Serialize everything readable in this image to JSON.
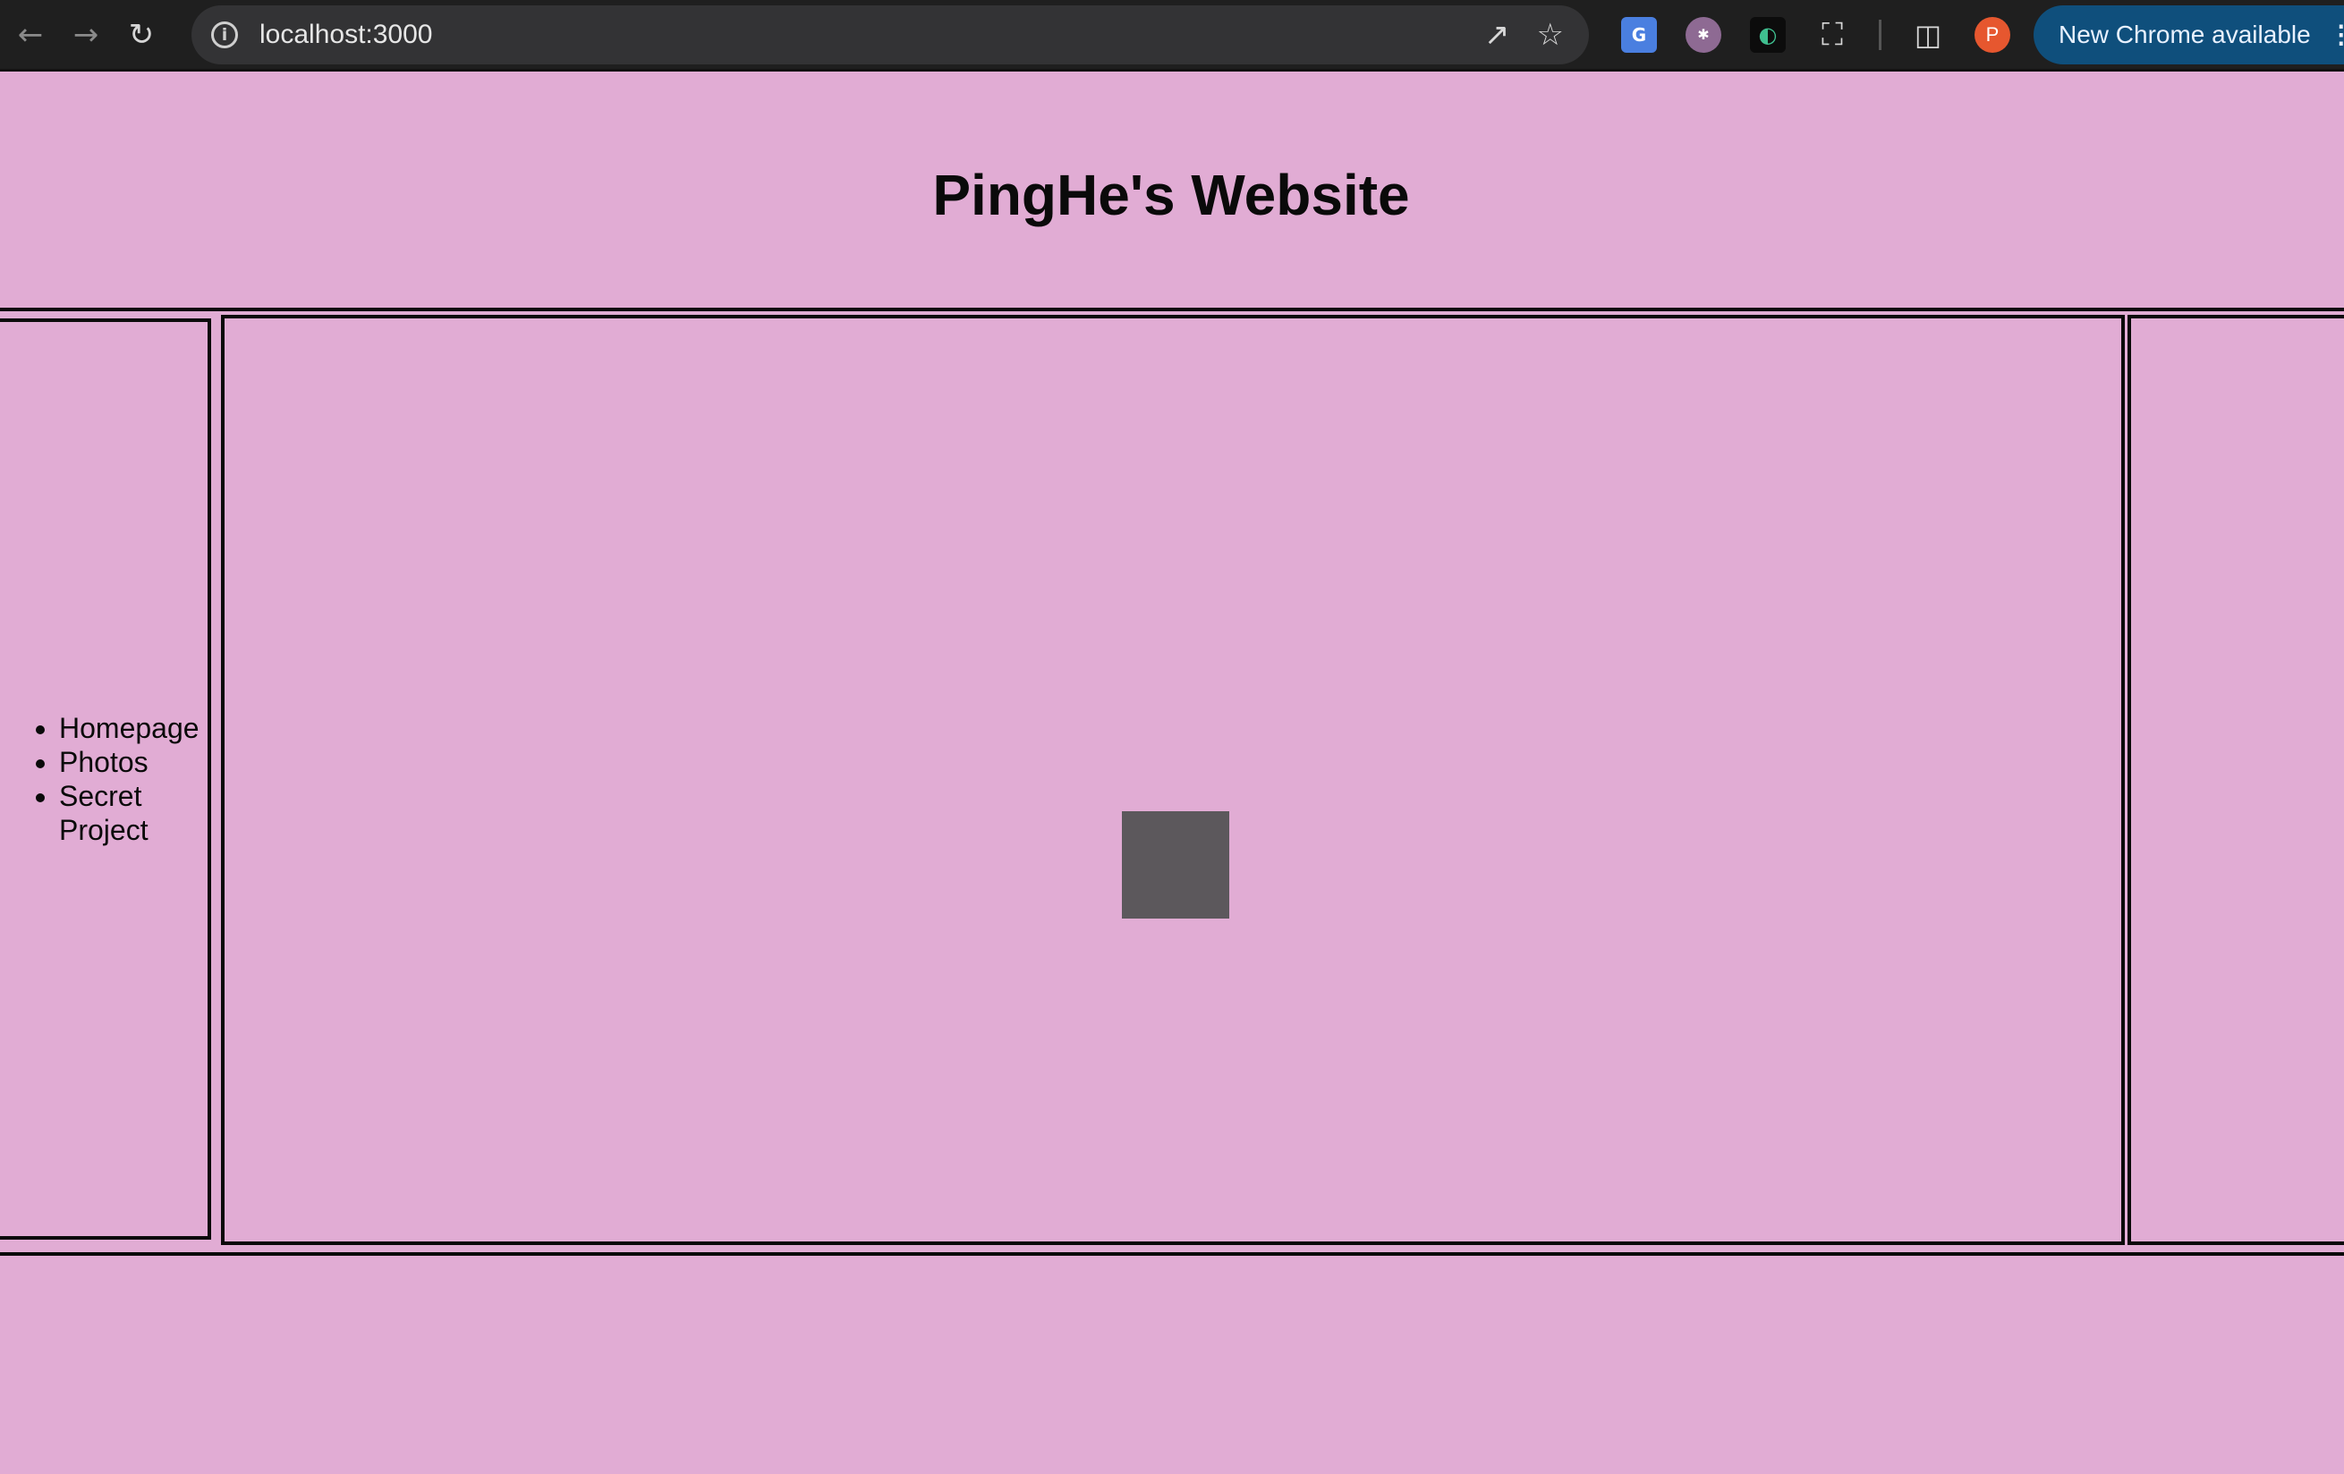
{
  "browser": {
    "url": "localhost:3000",
    "icons": {
      "back": "arrow-left-icon",
      "forward": "arrow-right-icon",
      "reload": "reload-icon",
      "site_info": "info-icon",
      "open_in_app": "open-external-icon",
      "bookmark": "star-icon",
      "extensions": "puzzle-icon",
      "side_panel": "side-panel-icon",
      "menu": "vertical-dots-icon"
    },
    "extension_translate": "G",
    "profile_initial": "P",
    "update_label": "New Chrome available"
  },
  "page": {
    "title": "PingHe's Website",
    "nav_items": [
      {
        "label": "Homepage"
      },
      {
        "label": "Photos"
      },
      {
        "label": "Secret Project"
      }
    ]
  },
  "colors": {
    "page_background": "#e1acd4",
    "border": "#0a0a0a",
    "placeholder_square": "#5c585c",
    "chrome_background": "#1f1f1f",
    "update_pill": "#0f4f7c",
    "avatar": "#e6572f"
  }
}
